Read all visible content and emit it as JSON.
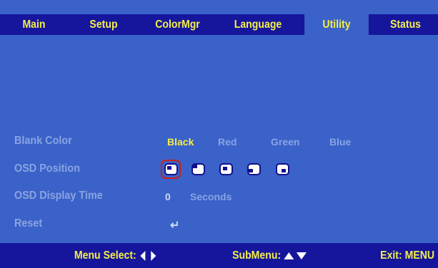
{
  "tabs": [
    {
      "label": "Main",
      "active": false
    },
    {
      "label": "Setup",
      "active": false
    },
    {
      "label": "ColorMgr",
      "active": false
    },
    {
      "label": "Language",
      "active": false
    },
    {
      "label": "Utility",
      "active": true
    },
    {
      "label": "Status",
      "active": false
    }
  ],
  "rows": {
    "blank_color": {
      "label": "Blank Color",
      "options": [
        "Black",
        "Red",
        "Green",
        "Blue"
      ],
      "selected": "Black"
    },
    "osd_position": {
      "label": "OSD Position",
      "icons": [
        "top-left-icon",
        "top-right-icon",
        "center-icon",
        "bottom-left-icon",
        "bottom-right-icon"
      ],
      "selected_index": 0
    },
    "osd_display_time": {
      "label": "OSD Display Time",
      "value": "0",
      "unit": "Seconds"
    },
    "reset": {
      "label": "Reset",
      "icon": "enter-icon",
      "glyph": "↵"
    }
  },
  "footer": {
    "menu_select": "Menu Select:",
    "submenu": "SubMenu:",
    "exit": "Exit: MENU"
  },
  "colors": {
    "background": "#3a62c8",
    "bar": "#15169c",
    "highlight": "#f4ee4c",
    "inactive_text": "#8aa3e4",
    "selection_ring": "#c8201c"
  }
}
